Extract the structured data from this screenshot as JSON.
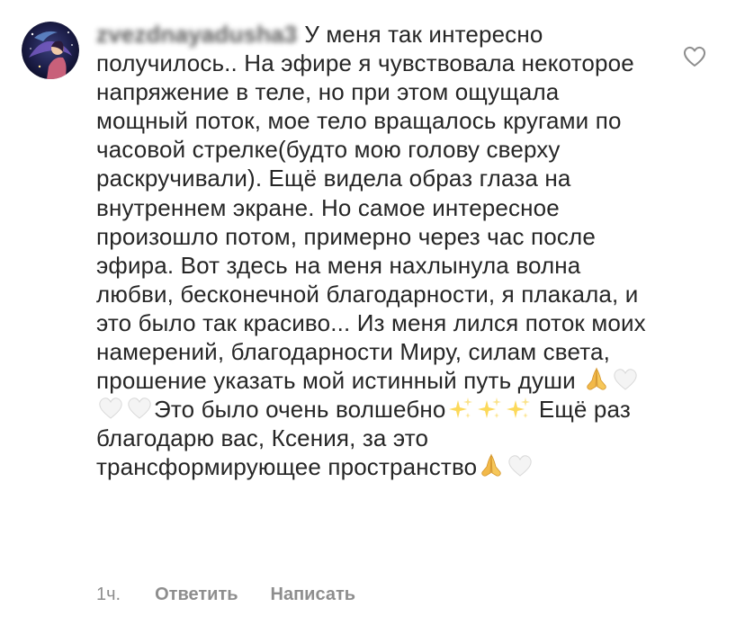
{
  "comment": {
    "username": "zvezdnayadusha3",
    "text_part1": "У меня так интересно получилось.. На эфире я чувствовала некоторое напряжение в теле, но при этом ощущала мощный поток, мое тело вращалось кругами по часовой стрелке(будто мою голову сверху раскручивали). Ещё видела образ глаза на внутреннем экране. Но самое интересное произошло потом, примерно через час после эфира. Вот здесь на меня нахлынула волна любви, бесконечной благодарности, я плакала, и это было так красиво... Из меня лился поток моих намерений, благодарности Миру, силам света, прошение указать мой истинный путь души",
    "text_part2": "Это было очень волшебно",
    "text_part3": "Ещё раз благодарю вас, Ксения, за это трансформирующее пространство",
    "emoji_names": [
      "folded-hands-emoji",
      "white-heart-emoji",
      "sparkles-emoji"
    ]
  },
  "meta": {
    "time": "1ч.",
    "reply_label": "Ответить",
    "message_label": "Написать"
  },
  "colors": {
    "text": "#262626",
    "secondary": "#8e8e8e",
    "background": "#ffffff"
  },
  "icons": {
    "like": "heart-outline-icon"
  }
}
